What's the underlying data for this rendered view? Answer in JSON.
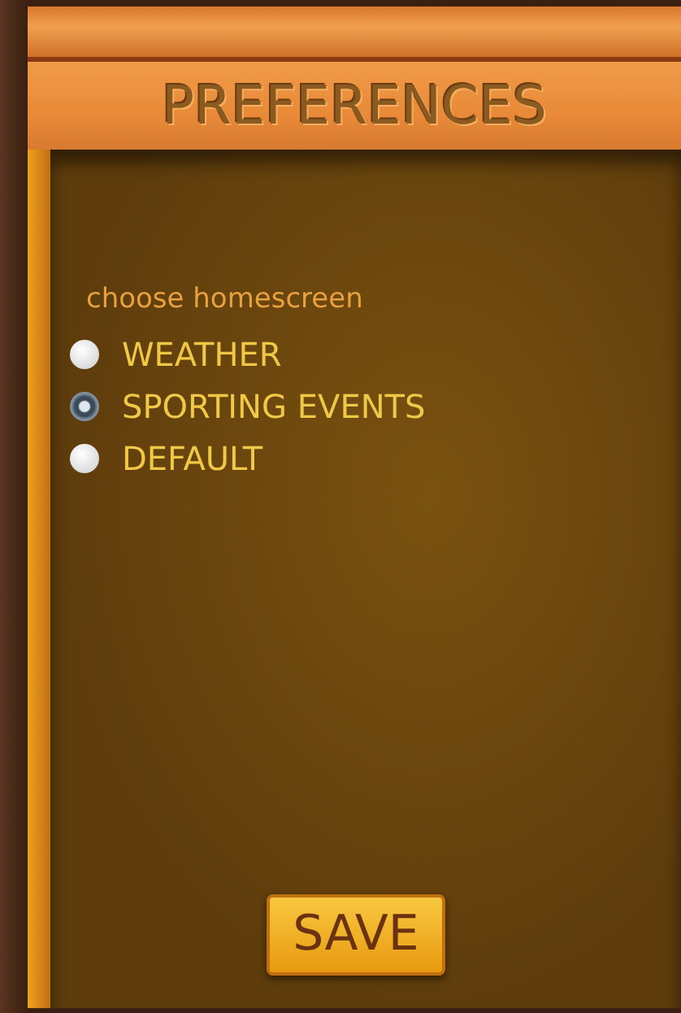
{
  "header": {
    "title": "PREFERENCES"
  },
  "homescreen": {
    "label": "choose homescreen",
    "options": [
      {
        "label": "WEATHER",
        "selected": false
      },
      {
        "label": "SPORTING EVENTS",
        "selected": true
      },
      {
        "label": "DEFAULT",
        "selected": false
      }
    ]
  },
  "buttons": [
    {
      "label": "SAVE"
    }
  ]
}
